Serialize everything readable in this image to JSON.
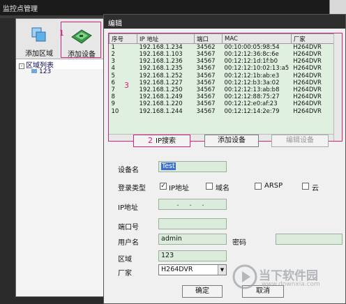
{
  "window": {
    "title": "监控点管理"
  },
  "toolbar": {
    "add_area": "添加区域",
    "add_device": "添加设备"
  },
  "tree": {
    "root": "区域列表",
    "child": "123"
  },
  "dialog": {
    "title": "编辑",
    "table": {
      "headers": [
        "序号",
        "IP 地址",
        "端口",
        "MAC",
        "厂家"
      ],
      "rows": [
        [
          "1",
          "192.168.1.234",
          "34562",
          "00:10:00:05:98:54",
          "H264DVR"
        ],
        [
          "2",
          "192.168.1.103",
          "34567",
          "00:12:12:36:8c:6e",
          "H264DVR"
        ],
        [
          "3",
          "192.168.1.236",
          "34567",
          "00:12:12:1d:1f:b0",
          "H264DVR"
        ],
        [
          "4",
          "192.168.1.235",
          "34567",
          "00:12:12:10:02:13:a5",
          "H264DVR"
        ],
        [
          "5",
          "192.168.1.252",
          "34567",
          "00:12:12:1b:ab:e3",
          "H264DVR"
        ],
        [
          "6",
          "192.168.1.227",
          "34567",
          "00:12:12:b3:3a:02",
          "H264DVR"
        ],
        [
          "7",
          "192.168.1.250",
          "34567",
          "00:12:12:13:ab:b8",
          "H264DVR"
        ],
        [
          "8",
          "192.168.1.249",
          "34567",
          "00:12:12:88:75:27",
          "H264DVR"
        ],
        [
          "9",
          "192.168.1.220",
          "34567",
          "00:12:12:e0:af:23",
          "H264DVR"
        ],
        [
          "10",
          "192.168.1.244",
          "34567",
          "00:12:12:14:2e:79",
          "H264DVR"
        ]
      ]
    },
    "buttons": {
      "ip_search": "IP搜索",
      "add_device": "添加设备",
      "edit_device": "编辑设备",
      "ok": "确定",
      "cancel": "取消"
    },
    "form": {
      "device_name_label": "设备名",
      "device_name_value": "Test",
      "login_type_label": "登录类型",
      "opt_ip": "IP地址",
      "opt_domain": "域名",
      "opt_arsp": "ARSP",
      "opt_cloud": "云",
      "ip_label": "IP地址",
      "ip_value": ". . .",
      "port_label": "端口号",
      "port_value": "",
      "user_label": "用户名",
      "user_value": "admin",
      "password_label": "密码",
      "password_value": "",
      "area_label": "区域",
      "area_value": "123",
      "vendor_label": "厂家",
      "vendor_value": "H264DVR"
    }
  },
  "annotations": {
    "n1": "1",
    "n2": "2",
    "n3": "3"
  },
  "watermark": {
    "text1": "当下软件园",
    "text2": "www.downxia.com"
  },
  "colors": {
    "highlight": "#d9207a",
    "field_bg": "#dcecdc",
    "list_bg": "#e0f0e0"
  }
}
